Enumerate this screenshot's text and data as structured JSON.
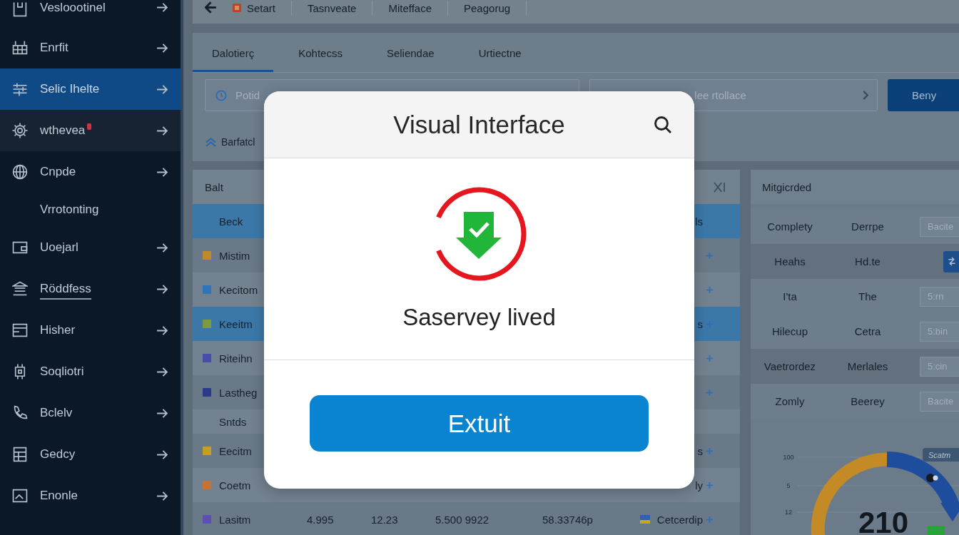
{
  "sidebar": {
    "items": [
      {
        "label": "Vesloootinel",
        "kind": "item",
        "selected": false,
        "highlighted": false,
        "alert": false,
        "underlined": false
      },
      {
        "label": "Enrfit",
        "kind": "item",
        "selected": false,
        "highlighted": false,
        "alert": false,
        "underlined": false
      },
      {
        "label": "Selic Ihelte",
        "kind": "item",
        "selected": true,
        "highlighted": false,
        "alert": false,
        "underlined": false
      },
      {
        "label": "wthevea",
        "kind": "item",
        "selected": false,
        "highlighted": true,
        "alert": true,
        "underlined": false
      },
      {
        "label": "Cnpde",
        "kind": "item",
        "selected": false,
        "highlighted": false,
        "alert": false,
        "underlined": false
      },
      {
        "label": "Vrrotonting",
        "kind": "sub",
        "selected": false,
        "highlighted": false,
        "alert": false,
        "underlined": false
      },
      {
        "label": "Uoejarl",
        "kind": "item",
        "selected": false,
        "highlighted": false,
        "alert": false,
        "underlined": false
      },
      {
        "label": "Röddfess",
        "kind": "item",
        "selected": false,
        "highlighted": false,
        "alert": false,
        "underlined": true
      },
      {
        "label": "Hisher",
        "kind": "item",
        "selected": false,
        "highlighted": false,
        "alert": false,
        "underlined": false
      },
      {
        "label": "Soqliotri",
        "kind": "item",
        "selected": false,
        "highlighted": false,
        "alert": false,
        "underlined": false
      },
      {
        "label": "Bclelv",
        "kind": "item",
        "selected": false,
        "highlighted": false,
        "alert": false,
        "underlined": false
      },
      {
        "label": "Gedcy",
        "kind": "item",
        "selected": false,
        "highlighted": false,
        "alert": false,
        "underlined": false
      },
      {
        "label": "Enonle",
        "kind": "item",
        "selected": false,
        "highlighted": false,
        "alert": false,
        "underlined": false
      }
    ]
  },
  "toolbar": {
    "items": [
      {
        "label": "Setart",
        "kind": "icon"
      },
      {
        "label": "Tasnveate",
        "kind": "text"
      },
      {
        "label": "Mitefface",
        "kind": "text"
      },
      {
        "label": "Peagorug",
        "kind": "text"
      }
    ]
  },
  "tabs": [
    {
      "label": "Dalotierç",
      "selected": true
    },
    {
      "label": "Kohtecss",
      "selected": false
    },
    {
      "label": "Seliendae",
      "selected": false
    },
    {
      "label": "Urtiectne",
      "selected": false
    }
  ],
  "search": {
    "placeholder": "Potid"
  },
  "filter": {
    "placeholder": "lee rtollace"
  },
  "action_button": {
    "label": "Beny"
  },
  "section": {
    "label": "Barfatcl"
  },
  "table": {
    "title": "Balt",
    "rows": [
      {
        "kind": "header",
        "name": "Beck",
        "tail": "ls",
        "selected": true
      },
      {
        "kind": "item",
        "name": "Mistim",
        "color": "#c08a2c",
        "selected": false
      },
      {
        "kind": "item",
        "name": "Kecitom",
        "color": "#2f74b6",
        "selected": false
      },
      {
        "kind": "item",
        "name": "Keeitm",
        "color": "#7a9c3e",
        "tail": "s",
        "selected": true
      },
      {
        "kind": "item",
        "name": "Riteihn",
        "color": "#4a4aa8",
        "selected": false
      },
      {
        "kind": "item",
        "name": "Lastheg",
        "color": "#2b3b8a",
        "selected": false
      },
      {
        "kind": "note",
        "name": "Sntds",
        "selected": false
      },
      {
        "kind": "item",
        "name": "Eecitm",
        "color": "#c4a022",
        "tail": "s",
        "selected": false
      },
      {
        "kind": "item",
        "name": "Coetm",
        "color": "#c47430",
        "tail": "ly",
        "selected": false
      },
      {
        "kind": "item",
        "name": "Lasitm",
        "color": "#5c50b5",
        "values": [
          "4.995",
          "12.23",
          "5.500 9922",
          "58.33746p"
        ],
        "tail": "Cetcerdip",
        "selected": false
      }
    ]
  },
  "panel": {
    "title": "Mitgicrded",
    "rows": [
      {
        "kind": "field",
        "label": "Complety",
        "detail": "Derrpe",
        "placeholder": "Bacite",
        "highlighted": false
      },
      {
        "kind": "action",
        "label": "Heahs",
        "detail": "Hd.te",
        "highlighted": true
      },
      {
        "kind": "field",
        "label": "I'ta",
        "detail": "The",
        "placeholder": "5:rn",
        "highlighted": false
      },
      {
        "kind": "field",
        "label": "Hilecup",
        "detail": "Cetra",
        "placeholder": "5:bin",
        "highlighted": false
      },
      {
        "kind": "field",
        "label": "Vaetrordez",
        "detail": "Merlales",
        "placeholder": "5:cin",
        "highlighted": true
      },
      {
        "kind": "field",
        "label": "Zomly",
        "detail": "Beerey",
        "placeholder": "Bacite",
        "highlighted": false
      }
    ],
    "gauge": {
      "value": "210",
      "ticks": [
        "100",
        "5",
        "12"
      ],
      "tag": "Scatm"
    }
  },
  "dialog": {
    "title": "Visual Interface",
    "message": "Saservey lived",
    "button": "Extuit"
  }
}
